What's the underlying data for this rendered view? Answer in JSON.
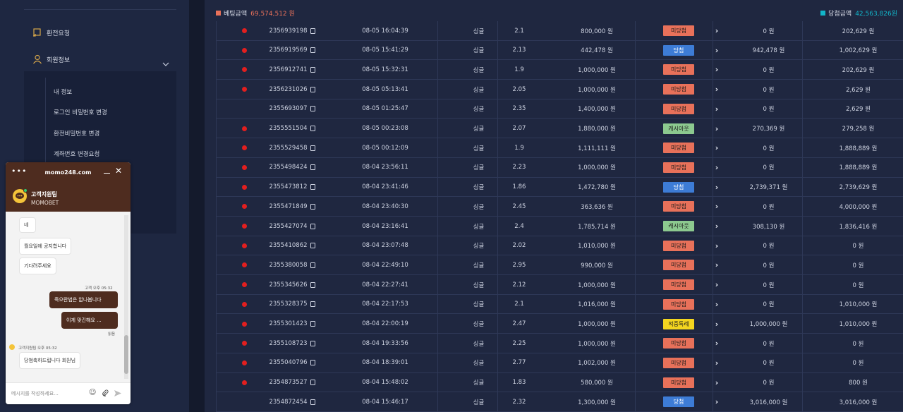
{
  "sidebar": {
    "items": [
      {
        "label": "환전요청",
        "icon": "exchange-icon"
      },
      {
        "label": "회원정보",
        "icon": "user-icon"
      }
    ],
    "submenu": [
      "내 정보",
      "로그인 비밀번호 변경",
      "환전비밀번호 변경",
      "계좌번호 변경요청"
    ]
  },
  "summary": {
    "bet_label": "베팅금액",
    "bet_value": "69,574,512 원",
    "win_label": "당첨금액",
    "win_value": "42,563,826원",
    "bet_color": "#e8715a",
    "win_color": "#12b5c9"
  },
  "rows": [
    {
      "dot": true,
      "id": "2356939198",
      "time": "08-05 16:04:39",
      "type": "싱글",
      "odds": "2.1",
      "bet": "800,000 원",
      "status": "미당첨",
      "cls": "b-lose",
      "win": "0 원",
      "bal": "202,629 원"
    },
    {
      "dot": true,
      "id": "2356919569",
      "time": "08-05 15:41:29",
      "type": "싱글",
      "odds": "2.13",
      "bet": "442,478 원",
      "status": "당첨",
      "cls": "b-win",
      "win": "942,478 원",
      "bal": "1,002,629 원"
    },
    {
      "dot": true,
      "id": "2356912741",
      "time": "08-05 15:32:31",
      "type": "싱글",
      "odds": "1.9",
      "bet": "1,000,000 원",
      "status": "미당첨",
      "cls": "b-lose",
      "win": "0 원",
      "bal": "202,629 원"
    },
    {
      "dot": true,
      "id": "2356231026",
      "time": "08-05 05:13:41",
      "type": "싱글",
      "odds": "2.05",
      "bet": "1,000,000 원",
      "status": "미당첨",
      "cls": "b-lose",
      "win": "0 원",
      "bal": "2,629 원"
    },
    {
      "dot": false,
      "id": "2355693097",
      "time": "08-05 01:25:47",
      "type": "싱글",
      "odds": "2.35",
      "bet": "1,400,000 원",
      "status": "미당첨",
      "cls": "b-lose",
      "win": "0 원",
      "bal": "2,629 원"
    },
    {
      "dot": true,
      "id": "2355551504",
      "time": "08-05 00:23:08",
      "type": "싱글",
      "odds": "2.07",
      "bet": "1,880,000 원",
      "status": "캐시아웃",
      "cls": "b-cash",
      "win": "270,369 원",
      "bal": "279,258 원"
    },
    {
      "dot": true,
      "id": "2355529458",
      "time": "08-05 00:12:09",
      "type": "싱글",
      "odds": "1.9",
      "bet": "1,111,111 원",
      "status": "미당첨",
      "cls": "b-lose",
      "win": "0 원",
      "bal": "1,888,889 원"
    },
    {
      "dot": true,
      "id": "2355498424",
      "time": "08-04 23:56:11",
      "type": "싱글",
      "odds": "2.23",
      "bet": "1,000,000 원",
      "status": "미당첨",
      "cls": "b-lose",
      "win": "0 원",
      "bal": "1,888,889 원"
    },
    {
      "dot": true,
      "id": "2355473812",
      "time": "08-04 23:41:46",
      "type": "싱글",
      "odds": "1.86",
      "bet": "1,472,780 원",
      "status": "당첨",
      "cls": "b-win",
      "win": "2,739,371 원",
      "bal": "2,739,629 원"
    },
    {
      "dot": true,
      "id": "2355471849",
      "time": "08-04 23:40:30",
      "type": "싱글",
      "odds": "2.45",
      "bet": "363,636 원",
      "status": "미당첨",
      "cls": "b-lose",
      "win": "0 원",
      "bal": "4,000,000 원"
    },
    {
      "dot": true,
      "id": "2355427074",
      "time": "08-04 23:16:41",
      "type": "싱글",
      "odds": "2.4",
      "bet": "1,785,714 원",
      "status": "캐시아웃",
      "cls": "b-cash",
      "win": "308,130 원",
      "bal": "1,836,416 원"
    },
    {
      "dot": true,
      "id": "2355410862",
      "time": "08-04 23:07:48",
      "type": "싱글",
      "odds": "2.02",
      "bet": "1,010,000 원",
      "status": "미당첨",
      "cls": "b-lose",
      "win": "0 원",
      "bal": "0 원"
    },
    {
      "dot": true,
      "id": "2355380058",
      "time": "08-04 22:49:10",
      "type": "싱글",
      "odds": "2.95",
      "bet": "990,000 원",
      "status": "미당첨",
      "cls": "b-lose",
      "win": "0 원",
      "bal": "0 원"
    },
    {
      "dot": true,
      "id": "2355345626",
      "time": "08-04 22:27:41",
      "type": "싱글",
      "odds": "2.12",
      "bet": "1,000,000 원",
      "status": "미당첨",
      "cls": "b-lose",
      "win": "0 원",
      "bal": "0 원"
    },
    {
      "dot": true,
      "id": "2355328375",
      "time": "08-04 22:17:53",
      "type": "싱글",
      "odds": "2.1",
      "bet": "1,016,000 원",
      "status": "미당첨",
      "cls": "b-lose",
      "win": "0 원",
      "bal": "1,010,000 원"
    },
    {
      "dot": true,
      "id": "2355301423",
      "time": "08-04 22:00:19",
      "type": "싱글",
      "odds": "2.47",
      "bet": "1,000,000 원",
      "status": "적중특례",
      "cls": "b-ref",
      "win": "1,000,000 원",
      "bal": "1,010,000 원"
    },
    {
      "dot": true,
      "id": "2355108723",
      "time": "08-04 19:33:56",
      "type": "싱글",
      "odds": "2.25",
      "bet": "1,000,000 원",
      "status": "미당첨",
      "cls": "b-lose",
      "win": "0 원",
      "bal": "0 원"
    },
    {
      "dot": true,
      "id": "2355040796",
      "time": "08-04 18:39:01",
      "type": "싱글",
      "odds": "2.77",
      "bet": "1,002,000 원",
      "status": "미당첨",
      "cls": "b-lose",
      "win": "0 원",
      "bal": "0 원"
    },
    {
      "dot": true,
      "id": "2354873527",
      "time": "08-04 15:48:02",
      "type": "싱글",
      "odds": "1.83",
      "bet": "580,000 원",
      "status": "미당첨",
      "cls": "b-lose",
      "win": "0 원",
      "bal": "800 원"
    },
    {
      "dot": false,
      "id": "2354872454",
      "time": "08-04 15:46:17",
      "type": "싱글",
      "odds": "2.32",
      "bet": "1,300,000 원",
      "status": "당첨",
      "cls": "b-win",
      "win": "3,016,000 원",
      "bal": "3,016,000 원"
    }
  ],
  "chat": {
    "site": "momo248.com",
    "agent_name": "고객지원팀",
    "brand": "MOMOBET",
    "messages_left": [
      "네",
      "월요일에 공지합니다",
      "기다려주세요"
    ],
    "meta_customer": "고객 오후 05:32",
    "messages_right": [
      "죽으란법은 없나봅니다",
      "이게 맞긴해요 ..."
    ],
    "read_label": "읽음",
    "meta_agent": "고객지원팀 오후 05:32",
    "last_agent_msg": "당첨축하드립니다 회원님",
    "input_placeholder": "메시지를 작성하세요..."
  }
}
